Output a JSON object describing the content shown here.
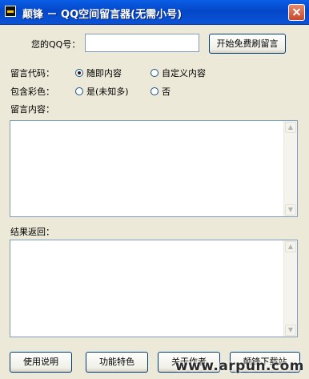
{
  "window": {
    "title": "颠锋 － QQ空间留言器(无需小号)"
  },
  "qq_row": {
    "label": "您的QQ号：",
    "value": "",
    "submit_label": "开始免费刷留言"
  },
  "code_row": {
    "label": "留言代码：",
    "option_random": "随即内容",
    "option_custom": "自定义内容",
    "selected": "随即内容"
  },
  "color_row": {
    "label": "包含彩色：",
    "option_yes": "是(未知多)",
    "option_no": "否",
    "selected": "none"
  },
  "content": {
    "label": "留言内容：",
    "value": ""
  },
  "result": {
    "label": "结果返回：",
    "value": ""
  },
  "footer": {
    "buttons": [
      "使用说明",
      "功能特色",
      "关于作者",
      "颠锋下载站"
    ]
  },
  "watermark": "www.arpun.com",
  "icons": [
    "app-icon",
    "close-icon",
    "radio-icon",
    "scroll-up-arrow-icon",
    "scroll-down-arrow-icon"
  ],
  "colors": {
    "titlebar": "#0447c9",
    "background": "#ece9d8",
    "button_border": "#003c74"
  }
}
